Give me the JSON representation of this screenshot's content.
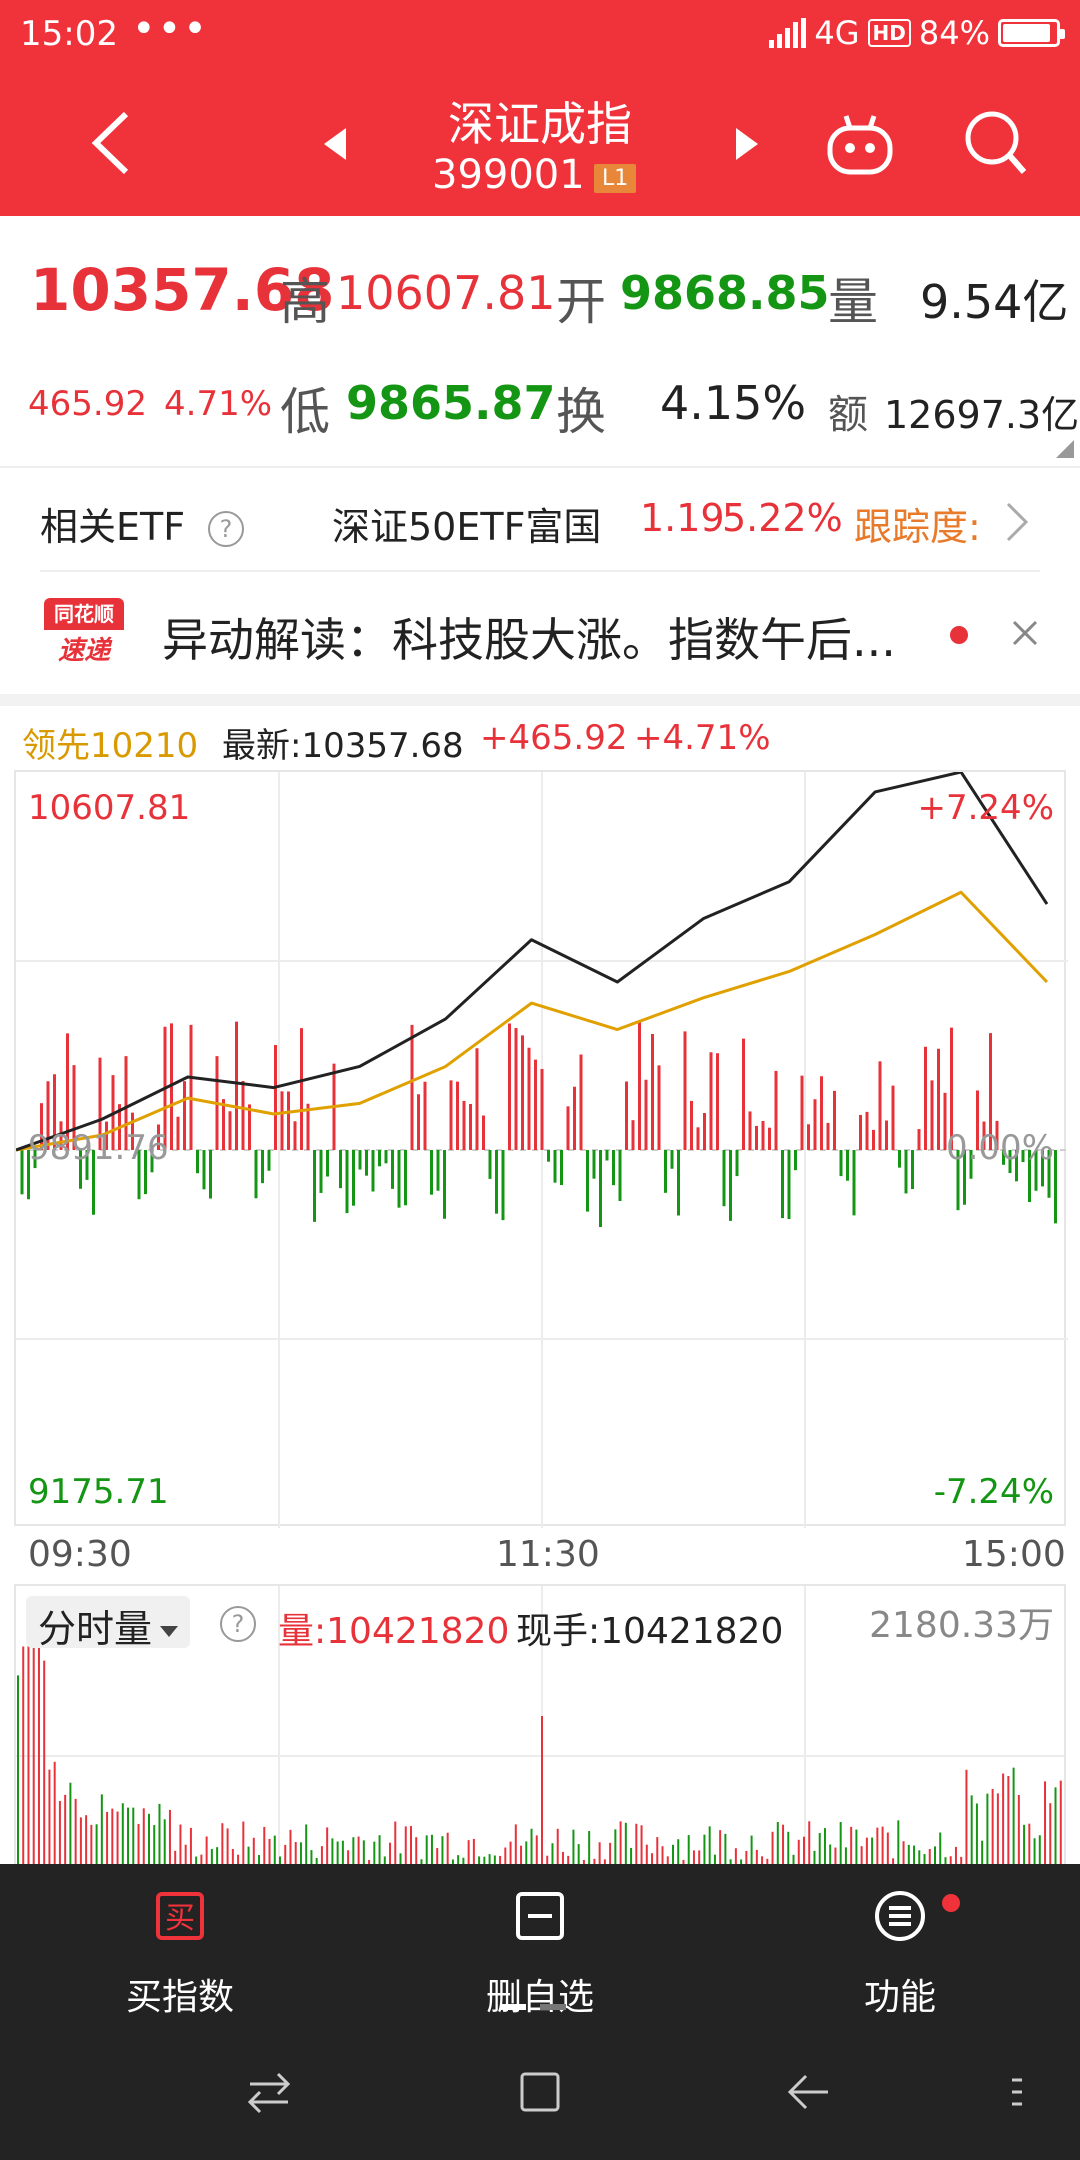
{
  "status_bar": {
    "time": "15:02",
    "dots": "•••",
    "network": "4G",
    "hd": "HD",
    "battery": "84%"
  },
  "nav": {
    "title": "深证成指",
    "code": "399001",
    "badge": "L1"
  },
  "quote": {
    "price": "10357.68",
    "change": "465.92",
    "change_pct": "4.71%",
    "high_label": "高",
    "high": "10607.81",
    "open_label": "开",
    "open": "9868.85",
    "vol_label": "量",
    "vol": "9.54亿",
    "low_label": "低",
    "low": "9865.87",
    "turnover_label": "换",
    "turnover": "4.15%",
    "amount_label": "额",
    "amount": "12697.3亿"
  },
  "etf": {
    "label": "相关ETF",
    "help": "?",
    "name": "深证50ETF富国",
    "price": "1.19",
    "pct": "5.22%",
    "track": "跟踪度:"
  },
  "news": {
    "logo_top": "同花顺",
    "logo_bottom": "速递",
    "text": "异动解读：科技股大涨。指数午后..."
  },
  "chart_header": {
    "lead": "领先10210",
    "latest": "最新:10357.68",
    "chg": "+465.92",
    "pct": "+4.71%"
  },
  "chart": {
    "y_high": "10607.81",
    "y_low": "9175.71",
    "pct_high": "+7.24%",
    "pct_low": "-7.24%",
    "zero_pct": "0.00%",
    "base": "9891.76",
    "times": [
      "09:30",
      "11:30",
      "15:00"
    ],
    "colors": {
      "up": "#e8323a",
      "down": "#149614",
      "index": "#222222",
      "lead": "#e0a000"
    }
  },
  "volume": {
    "dropdown": "分时量",
    "help": "?",
    "vol": "量:10421820",
    "now": "现手:10421820",
    "max": "2180.33万"
  },
  "toolbar": {
    "buy": "买指数",
    "remove": "删自选",
    "func": "功能",
    "buy_icon": "买"
  },
  "chart_data": {
    "type": "line",
    "x": [
      "09:30",
      "11:30",
      "15:00"
    ],
    "series": [
      {
        "values": [
          9891.76,
          9950,
          10030,
          10010,
          10050,
          10140,
          10290,
          10210,
          10330,
          10400,
          10570,
          10607.81,
          10357.68
        ]
      },
      {
        "values": [
          9891.76,
          9920,
          9990,
          9960,
          9980,
          10050,
          10170,
          10120,
          10180,
          10230,
          10300,
          10380,
          10210
        ]
      }
    ],
    "ylim": [
      9175.71,
      10607.81
    ]
  }
}
